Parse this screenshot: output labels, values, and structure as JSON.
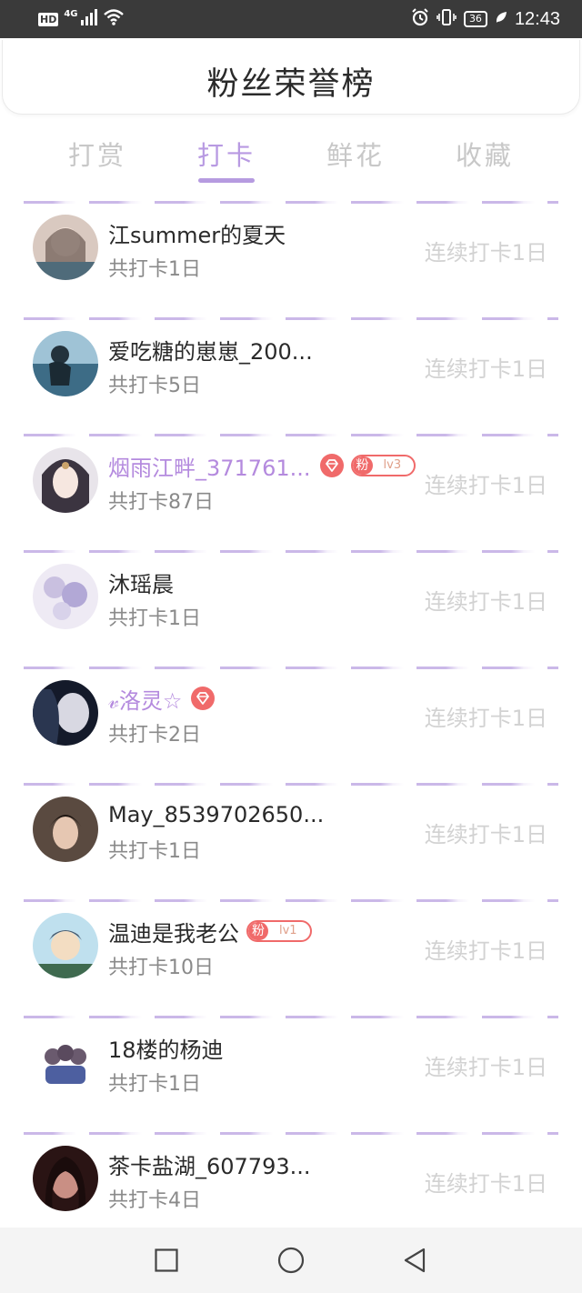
{
  "status_bar": {
    "hd": "HD",
    "network": "4G",
    "battery": "36",
    "time": "12:43"
  },
  "title": "粉丝荣誉榜",
  "tabs": [
    {
      "label": "打赏",
      "active": false
    },
    {
      "label": "打卡",
      "active": true
    },
    {
      "label": "鲜花",
      "active": false
    },
    {
      "label": "收藏",
      "active": false
    }
  ],
  "items": [
    {
      "name": "江summer的夏天",
      "total": "共打卡1日",
      "streak": "连续打卡1日",
      "vip": false
    },
    {
      "name": "爱吃糖的崽崽_200...",
      "total": "共打卡5日",
      "streak": "连续打卡1日",
      "vip": false
    },
    {
      "name": "烟雨江畔_371761...",
      "total": "共打卡87日",
      "streak": "连续打卡1日",
      "vip": true,
      "fan_label": "粉",
      "fan_level": "lv3"
    },
    {
      "name": "沐瑶晨",
      "total": "共打卡1日",
      "streak": "连续打卡1日",
      "vip": false
    },
    {
      "name": "𝓋洛灵☆",
      "total": "共打卡2日",
      "streak": "连续打卡1日",
      "vip": true
    },
    {
      "name": "May_8539702650...",
      "total": "共打卡1日",
      "streak": "连续打卡1日",
      "vip": false
    },
    {
      "name": "温迪是我老公",
      "total": "共打卡10日",
      "streak": "连续打卡1日",
      "vip": false,
      "fan_label": "粉",
      "fan_level": "lv1"
    },
    {
      "name": "18楼的杨迪",
      "total": "共打卡1日",
      "streak": "连续打卡1日",
      "vip": false
    },
    {
      "name": "茶卡盐湖_607793...",
      "total": "共打卡4日",
      "streak": "连续打卡1日",
      "vip": false
    }
  ],
  "nav": {
    "recent": "square-icon",
    "home": "circle-icon",
    "back": "triangle-back-icon"
  },
  "colors": {
    "accent": "#b89ae2",
    "vip_name": "#b48ade",
    "badge_red": "#f06a6a",
    "muted": "#d2d2d2"
  }
}
